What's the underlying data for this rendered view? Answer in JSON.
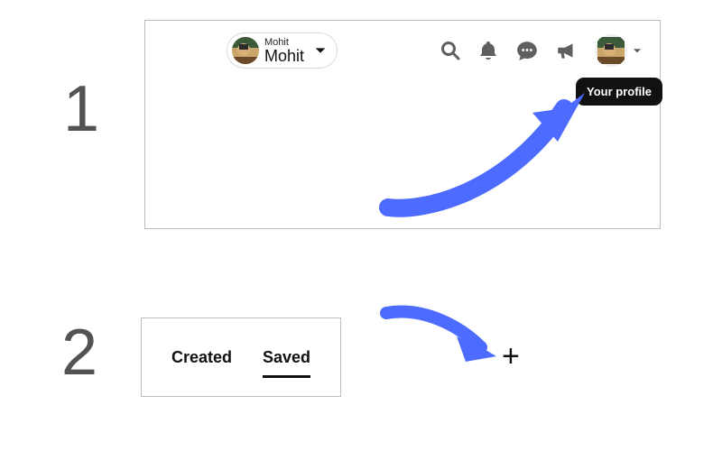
{
  "steps": {
    "one": "1",
    "two": "2"
  },
  "header": {
    "user_pill": {
      "name_small": "Mohit",
      "name_large": "Mohit"
    },
    "tooltip": "Your profile"
  },
  "tabs": {
    "created": "Created",
    "saved": "Saved",
    "active": "saved"
  },
  "plus_label": "+",
  "colors": {
    "arrow": "#4d6bff",
    "icon": "#5f5f5f",
    "tooltip_bg": "#111111"
  }
}
